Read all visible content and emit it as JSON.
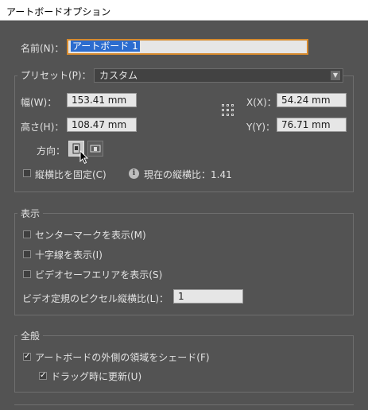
{
  "window": {
    "title": "アートボードオプション"
  },
  "name": {
    "label": "名前(N)：",
    "value": "アートボード 1"
  },
  "preset": {
    "label": "プリセット(P)：",
    "value": "カスタム"
  },
  "width": {
    "label": "幅(W)：",
    "value": "153.41 mm"
  },
  "height": {
    "label": "高さ(H)：",
    "value": "108.47 mm"
  },
  "x": {
    "label": "X(X)：",
    "value": "54.24 mm"
  },
  "y": {
    "label": "Y(Y)：",
    "value": "76.71 mm"
  },
  "orientation": {
    "label": "方向：",
    "selected": "portrait"
  },
  "constrain": {
    "label": "縦横比を固定(C)",
    "checked": false
  },
  "ratio": {
    "text": "現在の縦横比：1.41"
  },
  "display": {
    "legend": "表示",
    "center_mark": {
      "label": "センターマークを表示(M)",
      "checked": false
    },
    "cross_hairs": {
      "label": "十字線を表示(I)",
      "checked": false
    },
    "video_safe": {
      "label": "ビデオセーフエリアを表示(S)",
      "checked": false
    },
    "pixel_ratio": {
      "label": "ビデオ定規のピクセル縦横比(L)：",
      "value": "1"
    }
  },
  "general": {
    "legend": "全般",
    "fade_outside": {
      "label": "アートボードの外側の領域をシェード(F)",
      "checked": true
    },
    "update_drag": {
      "label": "ドラッグ時に更新(U)",
      "checked": true
    }
  },
  "colors": {
    "background": "#535353",
    "focus_border": "#d68a2e",
    "selection": "#2c6ccf"
  }
}
